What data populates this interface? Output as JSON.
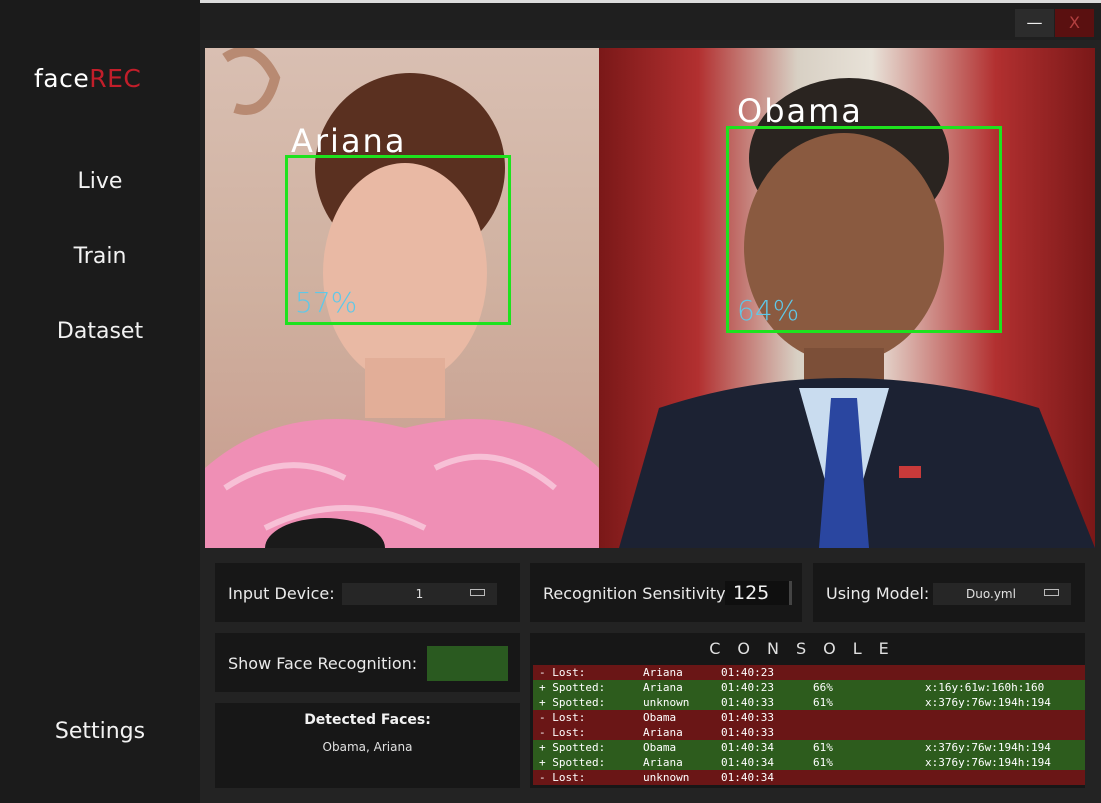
{
  "app": {
    "logo_prefix": "face",
    "logo_suffix": "REC",
    "minimize_label": "—",
    "close_label": "X"
  },
  "nav": {
    "live": "Live",
    "train": "Train",
    "dataset": "Dataset",
    "settings": "Settings"
  },
  "video": {
    "faces": [
      {
        "name": "Ariana",
        "confidence": "57%"
      },
      {
        "name": "Obama",
        "confidence": "64%"
      }
    ]
  },
  "controls": {
    "input_device_label": "Input Device:",
    "input_device_value": "1",
    "sensitivity_label": "Recognition Sensitivity:",
    "sensitivity_value": "125",
    "model_label": "Using Model:",
    "model_value": "Duo.yml",
    "show_face_label": "Show Face Recognition:",
    "detected_title": "Detected Faces:",
    "detected_value": "Obama, Ariana"
  },
  "console": {
    "title": "CONSOLE",
    "rows": [
      {
        "type": "lost",
        "event": "- Lost:",
        "name": "Ariana",
        "time": "01:40:23",
        "pct": "",
        "box": ""
      },
      {
        "type": "spot",
        "event": "+ Spotted:",
        "name": "Ariana",
        "time": "01:40:23",
        "pct": "66%",
        "box": "x:16y:61w:160h:160"
      },
      {
        "type": "spot",
        "event": "+ Spotted:",
        "name": "unknown",
        "time": "01:40:33",
        "pct": "61%",
        "box": "x:376y:76w:194h:194"
      },
      {
        "type": "lost",
        "event": "- Lost:",
        "name": "Obama",
        "time": "01:40:33",
        "pct": "",
        "box": ""
      },
      {
        "type": "lost",
        "event": "- Lost:",
        "name": "Ariana",
        "time": "01:40:33",
        "pct": "",
        "box": ""
      },
      {
        "type": "spot",
        "event": "+ Spotted:",
        "name": "Obama",
        "time": "01:40:34",
        "pct": "61%",
        "box": "x:376y:76w:194h:194"
      },
      {
        "type": "spot",
        "event": "+ Spotted:",
        "name": "Ariana",
        "time": "01:40:34",
        "pct": "61%",
        "box": "x:376y:76w:194h:194"
      },
      {
        "type": "lost",
        "event": "- Lost:",
        "name": "unknown",
        "time": "01:40:34",
        "pct": "",
        "box": ""
      }
    ]
  },
  "colors": {
    "accent_red": "#c21e2a",
    "box_green": "#1ee21e",
    "toggle_on": "#2a5a20",
    "lost_row": "#6a1616",
    "spotted_row": "#2d5c1d"
  }
}
